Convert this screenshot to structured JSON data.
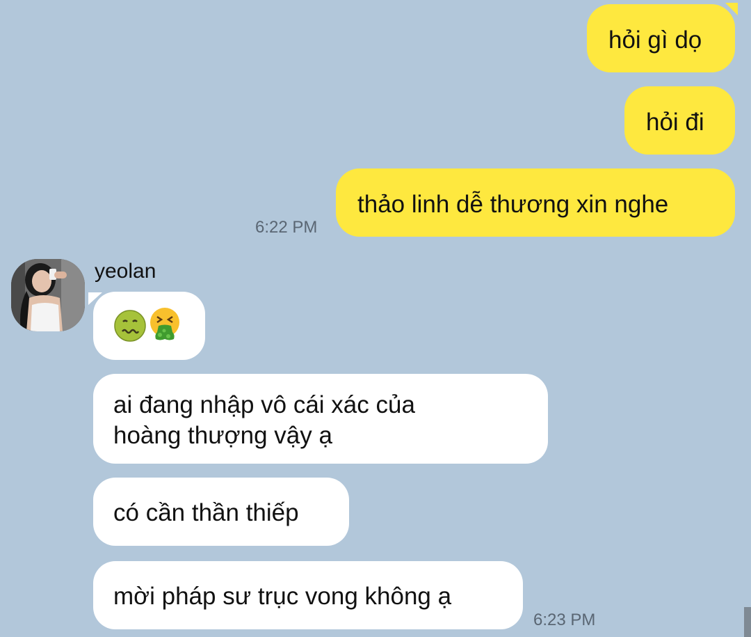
{
  "messages": {
    "outgoing": [
      {
        "text": "hỏi gì dọ"
      },
      {
        "text": "hỏi đi"
      },
      {
        "text": "thảo linh dễ thương xin nghe"
      }
    ],
    "outgoing_time": "6:22 PM",
    "sender_name": "yeolan",
    "incoming_emojis": [
      "nauseated-face",
      "vomiting-face"
    ],
    "incoming": [
      {
        "lines": [
          "ai đang nhập vô cái xác của",
          "hoàng thượng vậy ạ"
        ]
      },
      {
        "text": "có cần thần thiếp"
      },
      {
        "text": "mời pháp sư trục vong không ạ"
      }
    ],
    "incoming_time": "6:23 PM"
  },
  "colors": {
    "background": "#b2c7da",
    "outgoing_bubble": "#fee83f",
    "incoming_bubble": "#ffffff",
    "timestamp": "#5a6673"
  }
}
